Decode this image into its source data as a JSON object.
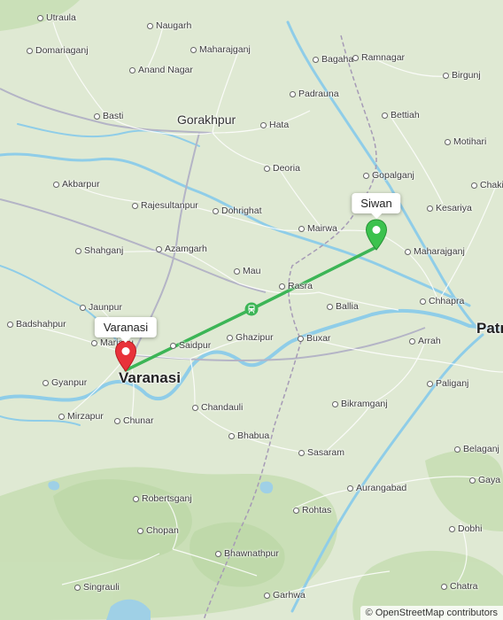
{
  "map": {
    "colors": {
      "land": "#dfe9d3",
      "forest": "#c8dfb5",
      "water": "#9fd0e6",
      "river": "#8fcde8",
      "major_road": "#b9b9c8",
      "route": "#3cb556",
      "origin_pin": "#e8323a",
      "destination_pin": "#3cc24e"
    }
  },
  "origin": {
    "label": "Varanasi",
    "icon": "map-pin-red-icon"
  },
  "destination": {
    "label": "Siwan",
    "icon": "map-pin-green-icon"
  },
  "route": {
    "mode_icon": "train-icon"
  },
  "attribution": "© OpenStreetMap contributors",
  "places": [
    {
      "name": "Utraula",
      "kind": "town"
    },
    {
      "name": "Naugarh",
      "kind": "town"
    },
    {
      "name": "Domariaganj",
      "kind": "town"
    },
    {
      "name": "Maharajganj",
      "kind": "town"
    },
    {
      "name": "Anand Nagar",
      "kind": "town"
    },
    {
      "name": "Bagaha",
      "kind": "town"
    },
    {
      "name": "Ramnagar",
      "kind": "town"
    },
    {
      "name": "Birgunj",
      "kind": "town"
    },
    {
      "name": "Padrauna",
      "kind": "town"
    },
    {
      "name": "Basti",
      "kind": "town"
    },
    {
      "name": "Gorakhpur",
      "kind": "major"
    },
    {
      "name": "Bettiah",
      "kind": "town"
    },
    {
      "name": "Hata",
      "kind": "town"
    },
    {
      "name": "Motihari",
      "kind": "town"
    },
    {
      "name": "Deoria",
      "kind": "town"
    },
    {
      "name": "Akbarpur",
      "kind": "town"
    },
    {
      "name": "Gopalganj",
      "kind": "town"
    },
    {
      "name": "Chakia",
      "kind": "town"
    },
    {
      "name": "Rajesultanpur",
      "kind": "town"
    },
    {
      "name": "Dohrighat",
      "kind": "town"
    },
    {
      "name": "Mairwa",
      "kind": "town"
    },
    {
      "name": "Kesariya",
      "kind": "town"
    },
    {
      "name": "Shahganj",
      "kind": "town"
    },
    {
      "name": "Azamgarh",
      "kind": "town"
    },
    {
      "name": "Maharajganj",
      "kind": "town"
    },
    {
      "name": "Mau",
      "kind": "town"
    },
    {
      "name": "Rasra",
      "kind": "town"
    },
    {
      "name": "Jaunpur",
      "kind": "town"
    },
    {
      "name": "Ballia",
      "kind": "town"
    },
    {
      "name": "Chhapra",
      "kind": "town"
    },
    {
      "name": "Badshahpur",
      "kind": "town"
    },
    {
      "name": "Mariahu",
      "kind": "town"
    },
    {
      "name": "Saidpur",
      "kind": "town"
    },
    {
      "name": "Ghazipur",
      "kind": "town"
    },
    {
      "name": "Buxar",
      "kind": "town"
    },
    {
      "name": "Arrah",
      "kind": "town"
    },
    {
      "name": "Patna",
      "kind": "metro"
    },
    {
      "name": "Gyanpur",
      "kind": "town"
    },
    {
      "name": "Varanasi",
      "kind": "metro"
    },
    {
      "name": "Paliganj",
      "kind": "town"
    },
    {
      "name": "Chandauli",
      "kind": "town"
    },
    {
      "name": "Mirzapur",
      "kind": "town"
    },
    {
      "name": "Bikramganj",
      "kind": "town"
    },
    {
      "name": "Chunar",
      "kind": "town"
    },
    {
      "name": "Bhabua",
      "kind": "town"
    },
    {
      "name": "Sasaram",
      "kind": "town"
    },
    {
      "name": "Belaganj",
      "kind": "town"
    },
    {
      "name": "Aurangabad",
      "kind": "town"
    },
    {
      "name": "Gaya",
      "kind": "town"
    },
    {
      "name": "Robertsganj",
      "kind": "town"
    },
    {
      "name": "Rohtas",
      "kind": "town"
    },
    {
      "name": "Chopan",
      "kind": "town"
    },
    {
      "name": "Dobhi",
      "kind": "town"
    },
    {
      "name": "Bhawnathpur",
      "kind": "town"
    },
    {
      "name": "Singrauli",
      "kind": "town"
    },
    {
      "name": "Chatra",
      "kind": "town"
    },
    {
      "name": "Garhwa",
      "kind": "town"
    }
  ]
}
